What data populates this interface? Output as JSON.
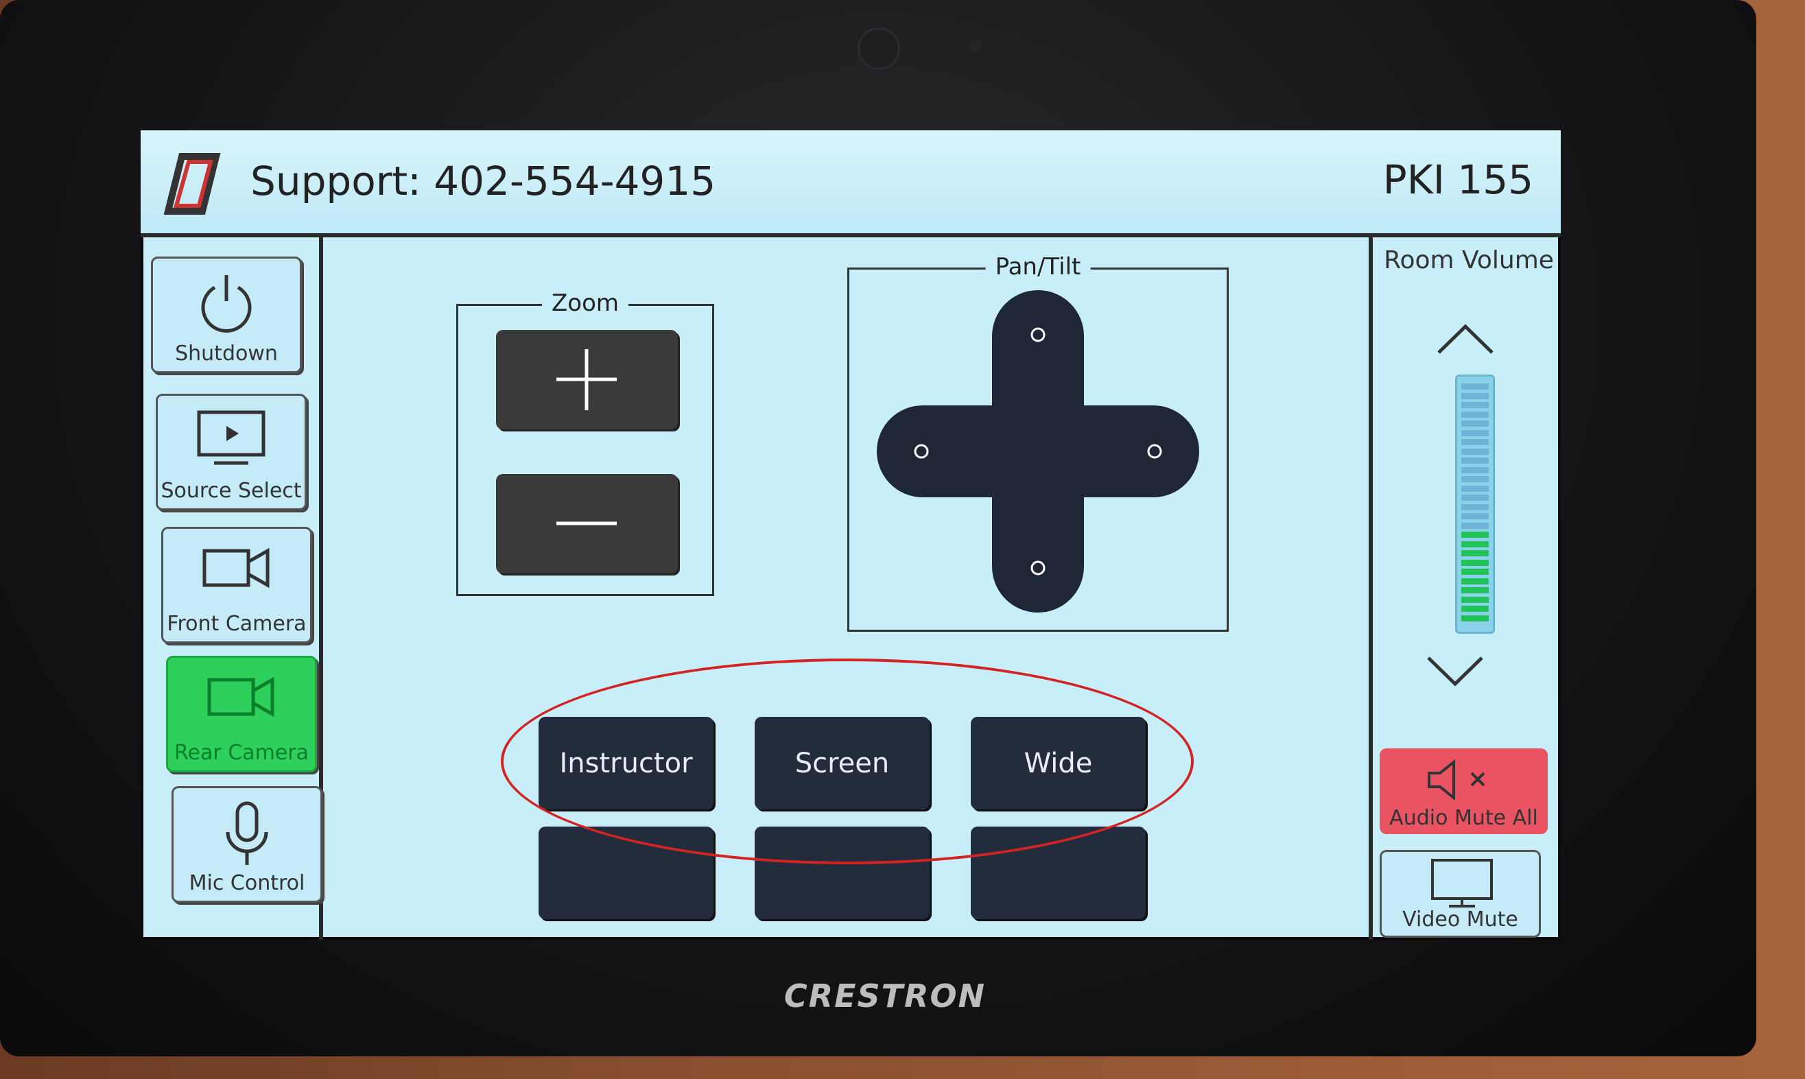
{
  "header": {
    "support_text": "Support: 402-554-4915",
    "room_name": "PKI 155"
  },
  "sidebar": {
    "items": [
      {
        "label": "Shutdown",
        "icon": "power-icon",
        "active": false
      },
      {
        "label": "Source Select",
        "icon": "monitor-play-icon",
        "active": false
      },
      {
        "label": "Front Camera",
        "icon": "video-camera-icon",
        "active": false
      },
      {
        "label": "Rear Camera",
        "icon": "video-camera-icon",
        "active": true
      },
      {
        "label": "Mic Control",
        "icon": "microphone-icon",
        "active": false
      }
    ]
  },
  "zoom": {
    "title": "Zoom",
    "in_icon": "plus-icon",
    "out_icon": "minus-icon"
  },
  "pantilt": {
    "title": "Pan/Tilt",
    "icon": "directional-pad-icon"
  },
  "presets": {
    "row1": [
      "Instructor",
      "Screen",
      "Wide"
    ],
    "row2": [
      "",
      "",
      ""
    ]
  },
  "volume": {
    "label": "Room Volume",
    "up_icon": "chevron-up-icon",
    "down_icon": "chevron-down-icon",
    "level_fraction": 0.38
  },
  "mute": {
    "audio_label": "Audio Mute All",
    "audio_icon": "speaker-mute-icon",
    "video_label": "Video Mute",
    "video_icon": "monitor-icon"
  },
  "device_brand": "CRESTRON",
  "colors": {
    "screen_bg": "#c8eef9",
    "active_green": "#2fcf5b",
    "mute_red": "#ea5361",
    "dark_button": "#3a3a3a",
    "preset_button": "#222c3c",
    "annotation_red": "#d32424"
  }
}
